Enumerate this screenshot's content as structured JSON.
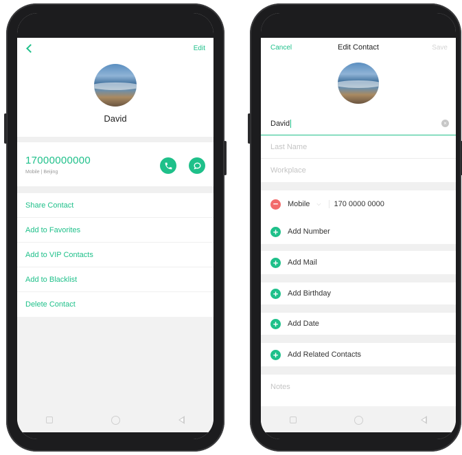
{
  "left_screen": {
    "edit_label": "Edit",
    "contact_name": "David",
    "phone_number": "17000000000",
    "phone_sub": "Mobile | Beijing",
    "actions": [
      "Share Contact",
      "Add to Favorites",
      "Add to VIP Contacts",
      "Add to Blacklist",
      "Delete Contact"
    ]
  },
  "right_screen": {
    "cancel_label": "Cancel",
    "title": "Edit Contact",
    "save_label": "Save",
    "first_name_value": "David",
    "last_name_placeholder": "Last Name",
    "workplace_placeholder": "Workplace",
    "phone_type": "Mobile",
    "phone_value": "170 0000 0000",
    "add_number": "Add Number",
    "add_mail": "Add Mail",
    "add_birthday": "Add Birthday",
    "add_date": "Add Date",
    "add_related": "Add Related Contacts",
    "notes_placeholder": "Notes"
  },
  "colors": {
    "accent": "#1fc08a",
    "danger": "#f26b6b"
  }
}
